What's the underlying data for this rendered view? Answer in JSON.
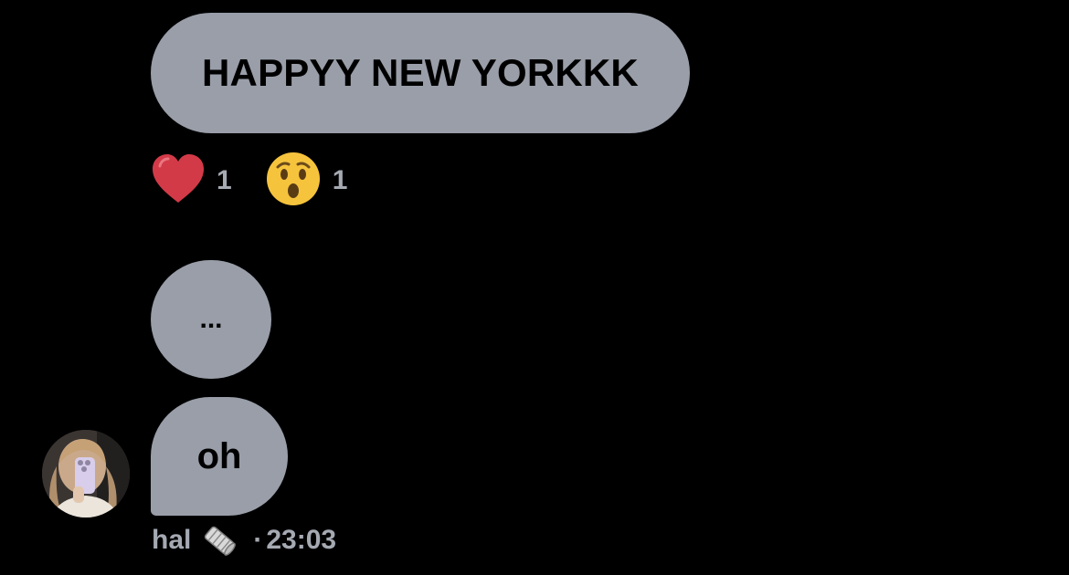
{
  "messages": [
    {
      "text": "HAPPYY NEW YORKKK"
    },
    {
      "text": "..."
    },
    {
      "text": "oh"
    }
  ],
  "reactions": [
    {
      "icon": "red-heart-icon",
      "count": "1"
    },
    {
      "icon": "astonished-face-icon",
      "count": "1"
    }
  ],
  "sender": {
    "name": "hal",
    "emoji_icon": "newspaper-roll-icon",
    "separator": "·",
    "time": "23:03"
  },
  "colors": {
    "background": "#000000",
    "bubble": "#999ea9",
    "meta_text": "#a5a9b2",
    "heart": "#d33a48",
    "emoji_face": "#f6c33d"
  }
}
